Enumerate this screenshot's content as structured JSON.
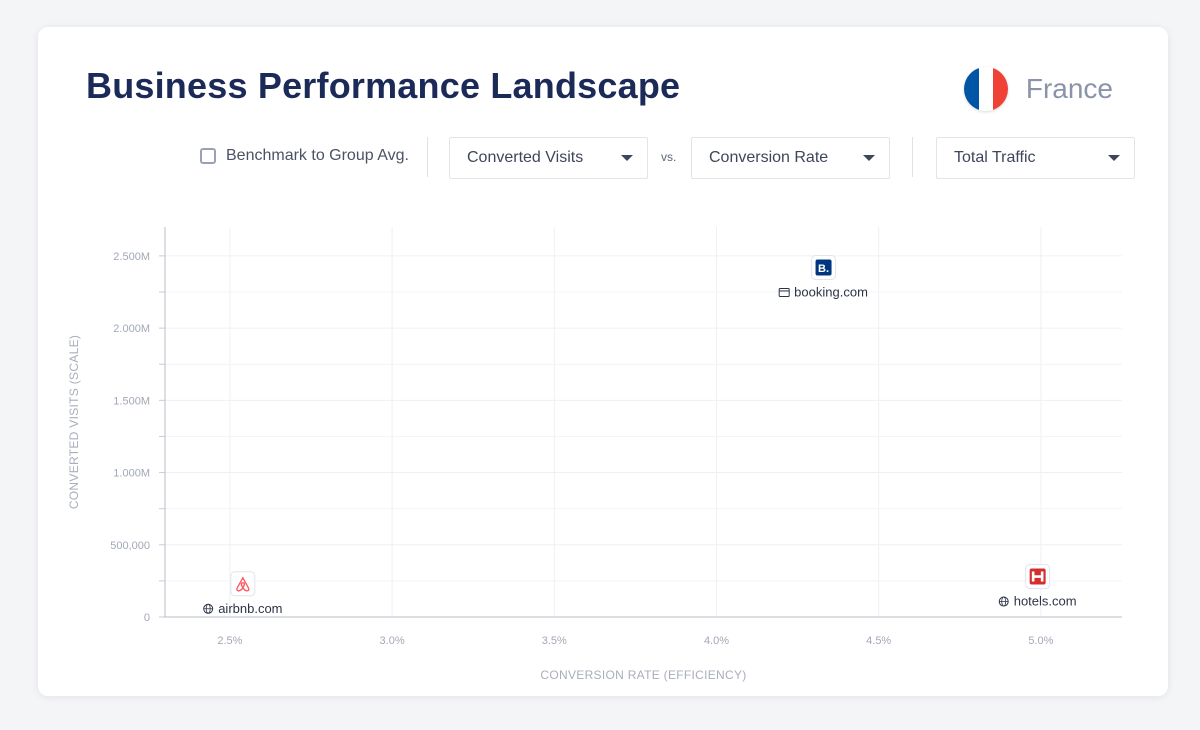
{
  "header": {
    "title": "Business Performance Landscape",
    "country": "France",
    "flag_colors": [
      "#0055A4",
      "#FFFFFF",
      "#EF4135"
    ]
  },
  "controls": {
    "benchmark_label": "Benchmark to Group Avg.",
    "benchmark_checked": false,
    "y_metric": "Converted Visits",
    "vs_label": "vs.",
    "x_metric": "Conversion Rate",
    "size_metric": "Total Traffic"
  },
  "chart_data": {
    "type": "scatter",
    "xlabel": "CONVERSION RATE (EFFICIENCY)",
    "ylabel": "CONVERTED VISITS (SCALE)",
    "xlim": [
      2.3,
      5.25
    ],
    "ylim": [
      0,
      2700000
    ],
    "x_ticks": [
      {
        "value": 2.5,
        "label": "2.5%"
      },
      {
        "value": 3.0,
        "label": "3.0%"
      },
      {
        "value": 3.5,
        "label": "3.5%"
      },
      {
        "value": 4.0,
        "label": "4.0%"
      },
      {
        "value": 4.5,
        "label": "4.5%"
      },
      {
        "value": 5.0,
        "label": "5.0%"
      }
    ],
    "y_ticks": [
      {
        "value": 0,
        "label": "0"
      },
      {
        "value": 500000,
        "label": "500,000"
      },
      {
        "value": 1000000,
        "label": "1.000M"
      },
      {
        "value": 1500000,
        "label": "1.500M"
      },
      {
        "value": 2000000,
        "label": "2.000M"
      },
      {
        "value": 2500000,
        "label": "2.500M"
      }
    ],
    "grid": true,
    "points": [
      {
        "name": "airbnb.com",
        "x": 2.54,
        "y": 230000,
        "icon": "airbnb-logo-icon",
        "label_icon": "globe-icon",
        "color": "#FF5A5F"
      },
      {
        "name": "booking.com",
        "x": 4.33,
        "y": 2420000,
        "icon": "booking-logo-icon",
        "label_icon": "browser-window-icon",
        "color": "#003580"
      },
      {
        "name": "hotels.com",
        "x": 4.99,
        "y": 280000,
        "icon": "hotels-logo-icon",
        "label_icon": "globe-icon",
        "color": "#D32F2F"
      }
    ]
  }
}
